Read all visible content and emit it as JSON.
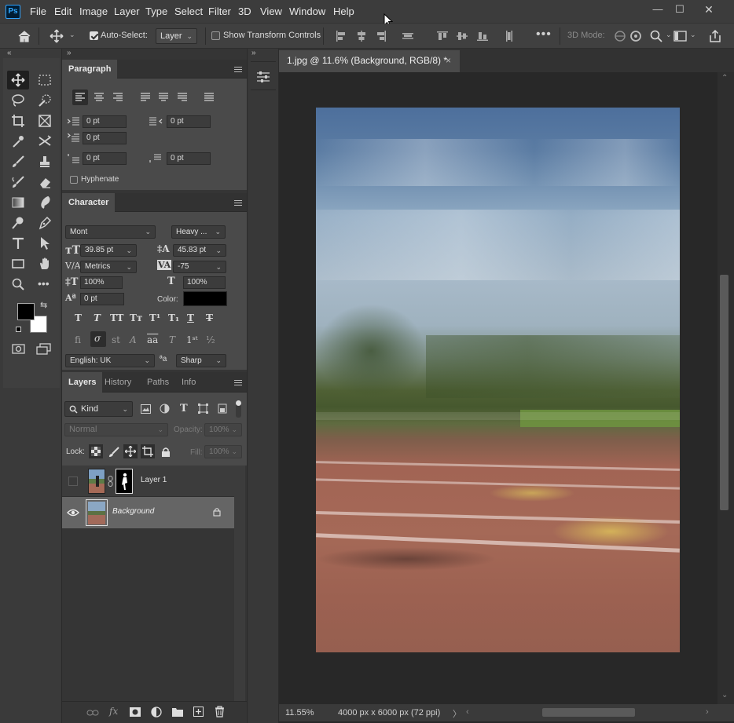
{
  "app": {
    "logo": "Ps"
  },
  "menu": [
    "File",
    "Edit",
    "Image",
    "Layer",
    "Type",
    "Select",
    "Filter",
    "3D",
    "View",
    "Window",
    "Help"
  ],
  "window_controls": {
    "minimize": "—",
    "maximize": "☐",
    "close": "✕"
  },
  "options": {
    "auto_select_label": "Auto-Select:",
    "auto_select_target": "Layer",
    "show_transform_label": "Show Transform Controls",
    "three_d_mode_label": "3D Mode:"
  },
  "paragraph": {
    "tab": "Paragraph",
    "indent_left": "0 pt",
    "indent_right": "0 pt",
    "indent_first": "0 pt",
    "space_before": "0 pt",
    "space_after": "0 pt",
    "hyphenate_label": "Hyphenate"
  },
  "character": {
    "tab": "Character",
    "font_family": "Mont",
    "font_style": "Heavy ...",
    "size": "39.85 pt",
    "leading": "45.83 pt",
    "kerning": "Metrics",
    "tracking": "-75",
    "vscale": "100%",
    "hscale": "100%",
    "baseline": "0 pt",
    "color_label": "Color:",
    "language": "English: UK",
    "aa_icon": "ªa",
    "antialias": "Sharp"
  },
  "layers_panel": {
    "tabs": [
      "Layers",
      "History",
      "Paths",
      "Info"
    ],
    "filter_kind": "Kind",
    "blend_mode": "Normal",
    "opacity_label": "Opacity:",
    "opacity": "100%",
    "lock_label": "Lock:",
    "fill_label": "Fill:",
    "fill": "100%",
    "layers": [
      {
        "name": "Layer 1",
        "visible": false,
        "selected": false
      },
      {
        "name": "Background",
        "visible": true,
        "selected": true
      }
    ]
  },
  "document": {
    "tab_title": "1.jpg @ 11.6% (Background, RGB/8) *",
    "close": "×"
  },
  "status": {
    "zoom": "11.55%",
    "info": "4000 px x 6000 px (72 ppi)"
  },
  "colors": {
    "foreground": "#000000",
    "background": "#ffffff",
    "text_color_swatch": "#000000",
    "accent": "#31a8ff"
  }
}
